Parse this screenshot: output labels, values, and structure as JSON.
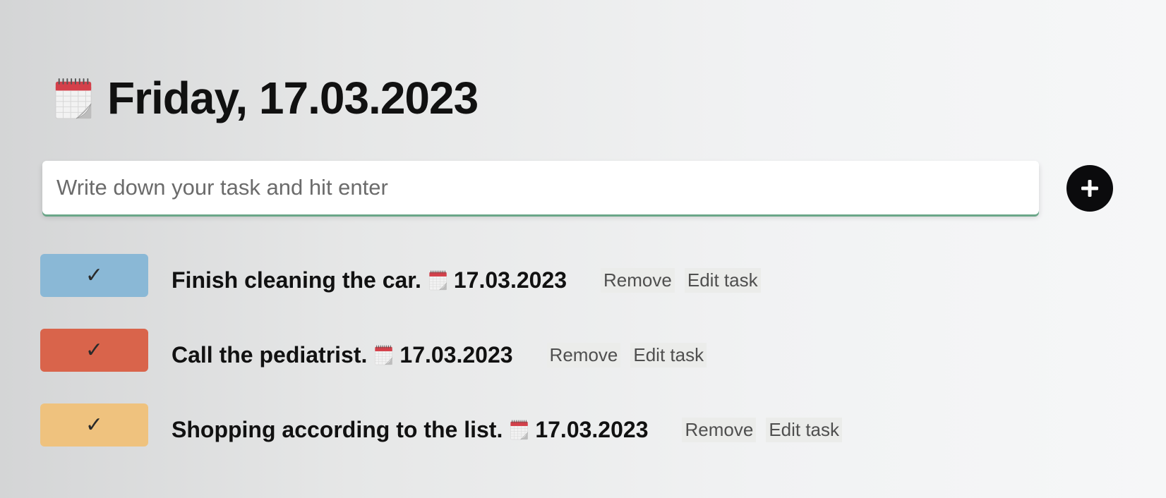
{
  "header": {
    "date_title": "Friday, 17.03.2023",
    "icon": "calendar-icon"
  },
  "task_input": {
    "placeholder": "Write down your task and hit enter",
    "value": ""
  },
  "add_button": {
    "icon": "plus-icon"
  },
  "colors": {
    "task_blue": "#8ab8d6",
    "task_red": "#d9644b",
    "task_orange": "#efc27e",
    "input_underline": "#6aa688",
    "add_button_bg": "#0b0b0d"
  },
  "tasks": [
    {
      "check_symbol": "✓",
      "text": "Finish cleaning the car.",
      "date": "17.03.2023",
      "remove_label": "Remove",
      "edit_label": "Edit task"
    },
    {
      "check_symbol": "✓",
      "text": "Call the pediatrist.",
      "date": "17.03.2023",
      "remove_label": "Remove",
      "edit_label": "Edit task"
    },
    {
      "check_symbol": "✓",
      "text": "Shopping according to the list.",
      "date": "17.03.2023",
      "remove_label": "Remove",
      "edit_label": "Edit task"
    }
  ]
}
